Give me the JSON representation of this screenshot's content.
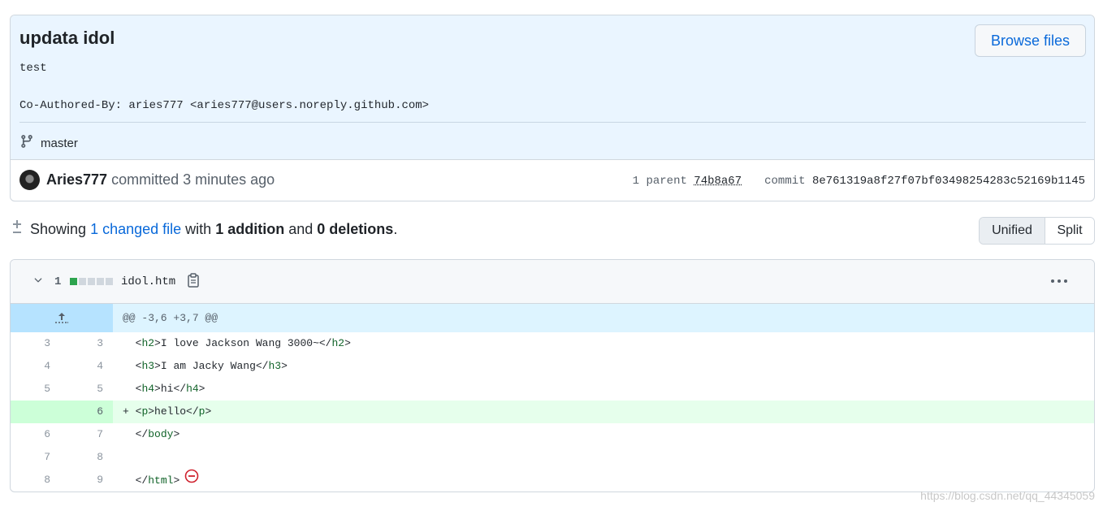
{
  "commit": {
    "title": "updata idol",
    "description_line1": "test",
    "description_line2": "Co-Authored-By: aries777 <aries777@users.noreply.github.com>",
    "browse_label": "Browse files",
    "branch": "master",
    "author": "Aries777",
    "committed_text": "committed 3 minutes ago",
    "parent_label": "1 parent",
    "parent_sha": "74b8a67",
    "commit_label": "commit",
    "commit_sha": "8e761319a8f27f07bf03498254283c52169b1145"
  },
  "summary": {
    "prefix": "Showing",
    "changed_files": "1 changed file",
    "with": "with",
    "additions": "1 addition",
    "and": "and",
    "deletions": "0 deletions",
    "suffix": "."
  },
  "view_toggle": {
    "unified": "Unified",
    "split": "Split",
    "selected": "Unified"
  },
  "file": {
    "changes_count": "1",
    "name": "idol.htm",
    "hunk_header": "@@ -3,6 +3,7 @@",
    "lines": [
      {
        "old": "3",
        "new": "3",
        "marker": " ",
        "pre": "<",
        "tag": "h2",
        "mid": ">I love Jackson Wang 3000~</",
        "tag2": "h2",
        "post": ">"
      },
      {
        "old": "4",
        "new": "4",
        "marker": " ",
        "pre": "<",
        "tag": "h3",
        "mid": ">I am Jacky Wang</",
        "tag2": "h3",
        "post": ">"
      },
      {
        "old": "5",
        "new": "5",
        "marker": " ",
        "pre": "<",
        "tag": "h4",
        "mid": ">hi</",
        "tag2": "h4",
        "post": ">"
      },
      {
        "old": "",
        "new": "6",
        "marker": "+",
        "pre": "<",
        "tag": "p",
        "mid": ">hello</",
        "tag2": "p",
        "post": ">"
      },
      {
        "old": "6",
        "new": "7",
        "marker": " ",
        "pre": "</",
        "tag": "body",
        "mid": ">",
        "tag2": "",
        "post": ""
      },
      {
        "old": "7",
        "new": "8",
        "marker": " ",
        "pre": "",
        "tag": "",
        "mid": "",
        "tag2": "",
        "post": ""
      },
      {
        "old": "8",
        "new": "9",
        "marker": " ",
        "pre": "</",
        "tag": "html",
        "mid": ">",
        "tag2": "",
        "post": ""
      }
    ]
  },
  "watermark": "https://blog.csdn.net/qq_44345059",
  "colors": {
    "accent": "#0969da",
    "addition": "#2da44e",
    "header_bg": "#eaf5ff",
    "no_newline": "#cf222e"
  },
  "icons": {
    "branch": "git-branch-icon",
    "diff": "diff-icon",
    "chevron": "chevron-down-icon",
    "copy": "copy-icon",
    "menu": "kebab-horizontal-icon",
    "expand": "unfold-up-icon",
    "no_newline": "no-entry-icon"
  }
}
